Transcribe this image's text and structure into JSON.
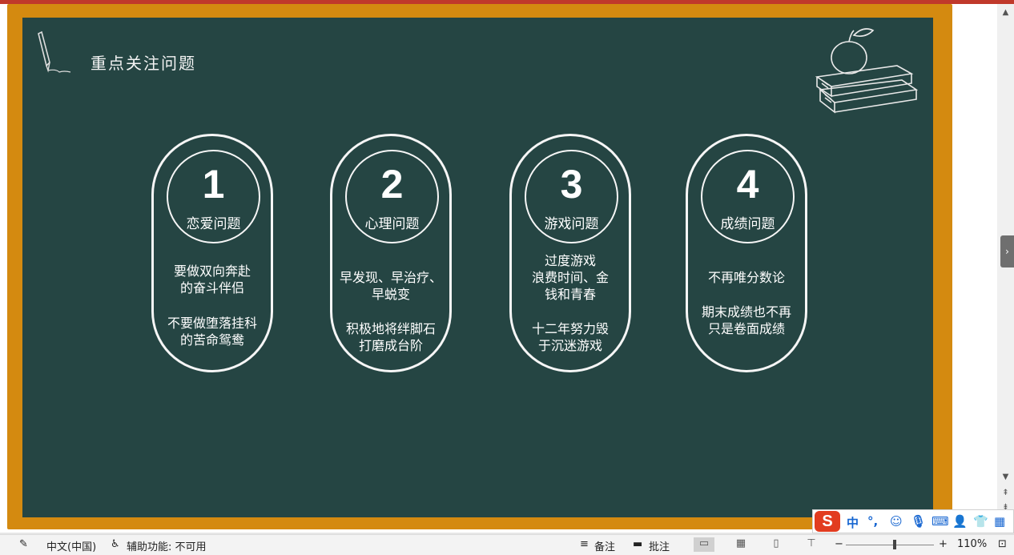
{
  "slide": {
    "title": "重点关注问题",
    "cards": [
      {
        "number": "1",
        "title": "恋爱问题",
        "desc1": [
          "要做双向奔赴",
          "的奋斗伴侣"
        ],
        "desc2": [
          "不要做堕落挂科",
          "的苦命鸳鸯"
        ]
      },
      {
        "number": "2",
        "title": "心理问题",
        "desc1": [
          "早发现、早治疗、",
          "早蜕变"
        ],
        "desc2": [
          "积极地将绊脚石",
          "打磨成台阶"
        ]
      },
      {
        "number": "3",
        "title": "游戏问题",
        "desc1": [
          "过度游戏",
          "浪费时间、金",
          "钱和青春"
        ],
        "desc2": [
          "十二年努力毁",
          "于沉迷游戏"
        ]
      },
      {
        "number": "4",
        "title": "成绩问题",
        "desc1": [
          "不再唯分数论"
        ],
        "desc2": [
          "期末成绩也不再",
          "只是卷面成绩"
        ]
      }
    ]
  },
  "ime": {
    "logo": "S",
    "lang": "中",
    "punct": "°,"
  },
  "statusbar": {
    "language": "中文(中国)",
    "accessibility": "辅助功能: 不可用",
    "notes": "备注",
    "comments": "批注",
    "zoom_minus": "−",
    "zoom_plus": "+",
    "zoom": "110%",
    "zoom_level": 0.55
  },
  "colors": {
    "board": "#254543",
    "frame": "#d48a10",
    "accent_red": "#c0392b"
  }
}
